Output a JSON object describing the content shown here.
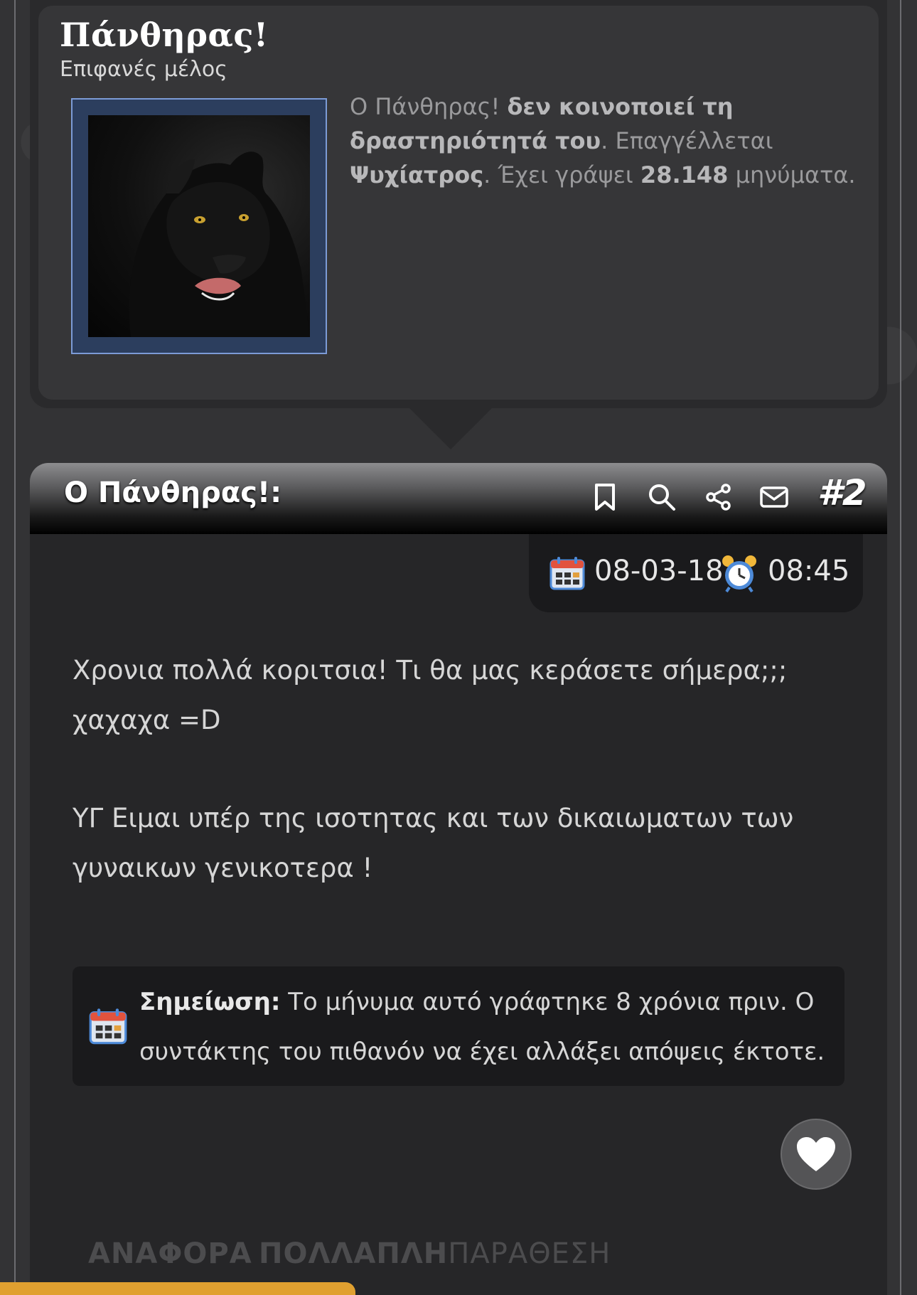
{
  "profile": {
    "name": "Πάνθηρας!",
    "rank": "Επιφανές μέλος",
    "bio_1": "Ο Πάνθηρας! ",
    "bio_2": "δεν κοινοποιεί τη δραστηριότητά του",
    "bio_3": ". Επαγγέλλεται ",
    "bio_4": "Ψυχίατρος",
    "bio_5": ". Έχει γράψει ",
    "bio_6": "28.148",
    "bio_7": " μηνύματα."
  },
  "post": {
    "author_label": "Ο Πάνθηρας!:",
    "number": "#2",
    "date": "08-03-18",
    "time": "08:45",
    "paragraph_1": "Χρονια πολλά κοριτσια! Τι θα μας κεράσετε σήμερα;;; χαχαχα =D",
    "paragraph_2": "ΥΓ Ειμαι υπέρ της ισοτητας και των δικαιωματων των γυναικων γενικοτερα !",
    "note_label": "Σημείωση:",
    "note_text": " Το μήνυμα αυτό γράφτηκε 8 χρόνια πριν. Ο συντάκτης του πιθανόν να έχει αλλάξει απόψεις έκτοτε."
  },
  "actions": {
    "bookmark_icon": "bookmark-icon",
    "search_icon": "search-icon",
    "share_icon": "share-icon",
    "mail_icon": "mail-icon",
    "like_icon": "heart-icon",
    "reply_label": "ΑΝΑΦΟΡΑ",
    "multiquote_label_1": "ΠΟΛΛΑΠΛΗ",
    "multiquote_label_2": "ΠΑΡΑΘΕΣΗ"
  },
  "colors": {
    "background": "#333335",
    "accent_bar": "#e0a030",
    "avatar_border": "#7c9bd6"
  }
}
